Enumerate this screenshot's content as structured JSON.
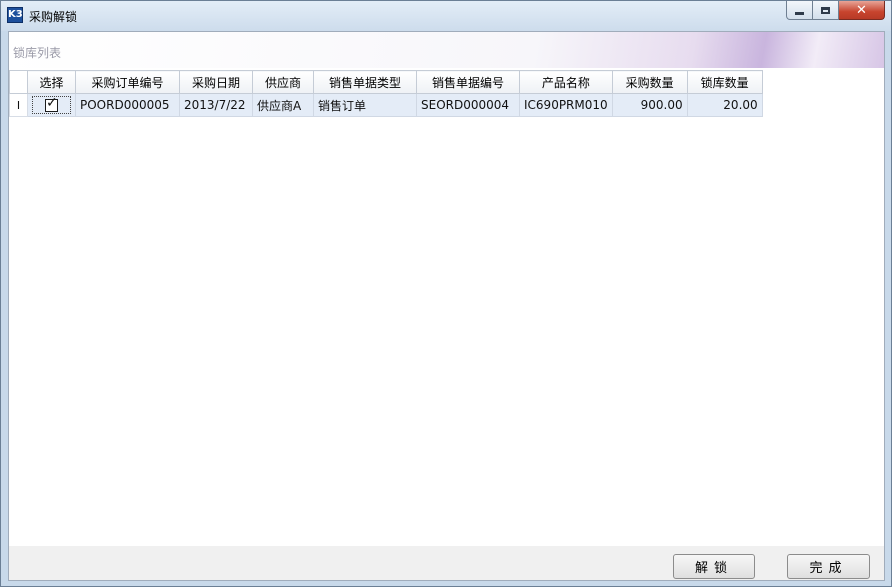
{
  "window": {
    "title": "采购解锁",
    "app_icon_glyph": "K3",
    "controls": {
      "minimize": "minimize-icon",
      "maximize": "maximize-icon",
      "close": "close-icon",
      "close_glyph": "✕"
    }
  },
  "group": {
    "label": "锁库列表"
  },
  "grid": {
    "columns": [
      "选择",
      "采购订单编号",
      "采购日期",
      "供应商",
      "销售单据类型",
      "销售单据编号",
      "产品名称",
      "采购数量",
      "锁库数量"
    ],
    "rows": [
      {
        "indicator": "I",
        "selected": true,
        "po_number": "POORD000005",
        "po_date": "2013/7/22",
        "supplier": "供应商A",
        "sales_doc_type": "销售订单",
        "sales_doc_number": "SEORD000004",
        "product_name": "IC690PRM010",
        "purchase_qty": "900.00",
        "locked_qty": "20.00"
      }
    ]
  },
  "buttons": {
    "unlock": "解锁",
    "done": "完成"
  },
  "colors": {
    "selected_row": "#e4ecf7",
    "close_button": "#c7442e"
  }
}
